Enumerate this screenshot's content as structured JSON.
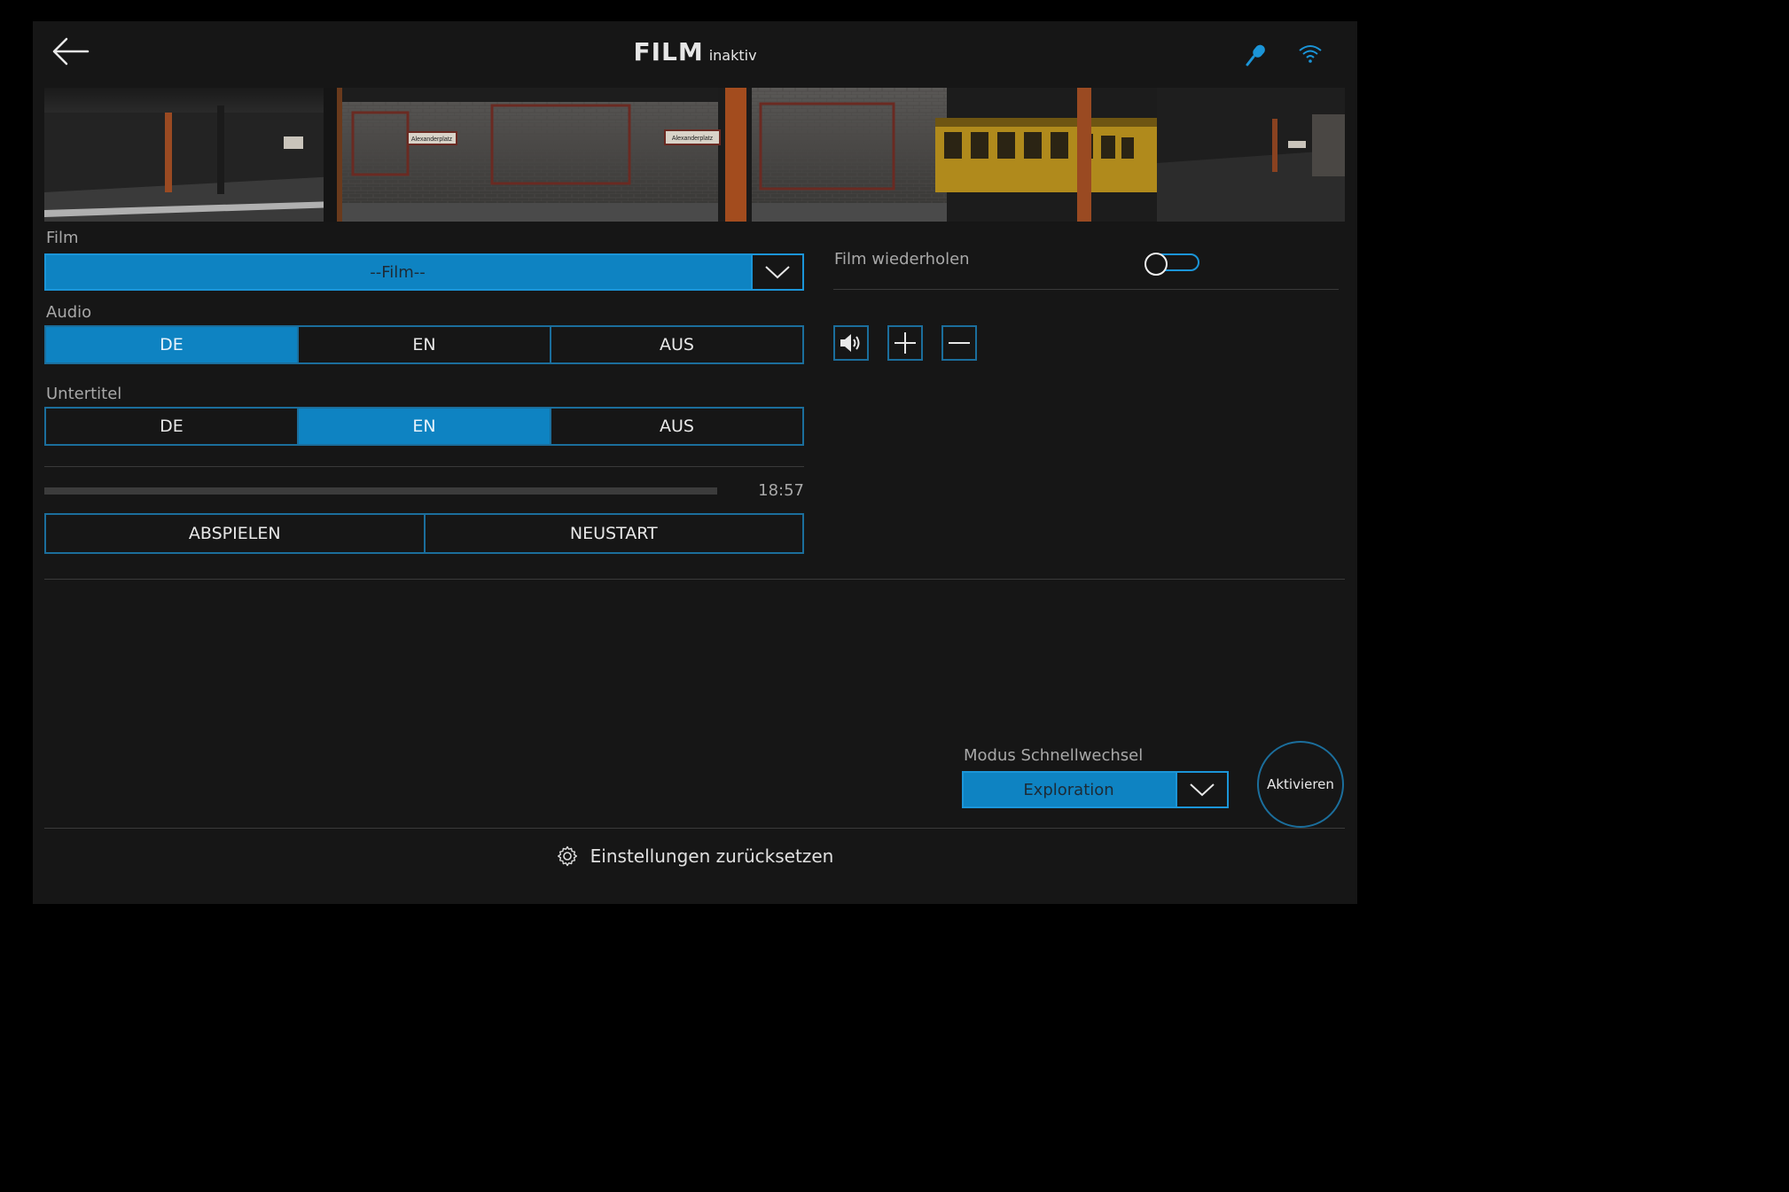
{
  "header": {
    "title": "FILM",
    "status": "inaktiv"
  },
  "film": {
    "label": "Film",
    "selected": "--Film--"
  },
  "audio": {
    "label": "Audio",
    "options": [
      "DE",
      "EN",
      "AUS"
    ],
    "active_index": 0
  },
  "subtitles": {
    "label": "Untertitel",
    "options": [
      "DE",
      "EN",
      "AUS"
    ],
    "active_index": 1
  },
  "progress": {
    "time": "18:57",
    "fraction": 0.0
  },
  "playback": {
    "play_label": "ABSPIELEN",
    "restart_label": "NEUSTART"
  },
  "repeat": {
    "label": "Film wiederholen",
    "enabled": false
  },
  "volume": {
    "icons": [
      "speaker-icon",
      "plus-icon",
      "minus-icon"
    ]
  },
  "quick_mode": {
    "label": "Modus Schnellwechsel",
    "selected": "Exploration",
    "activate_label": "Aktivieren"
  },
  "footer": {
    "reset_label": "Einstellungen zurücksetzen"
  },
  "colors": {
    "accent": "#0e83c2",
    "background": "#161616",
    "border": "#1b6e9c"
  },
  "banner": {
    "sign_text": "Alexanderplatz"
  }
}
